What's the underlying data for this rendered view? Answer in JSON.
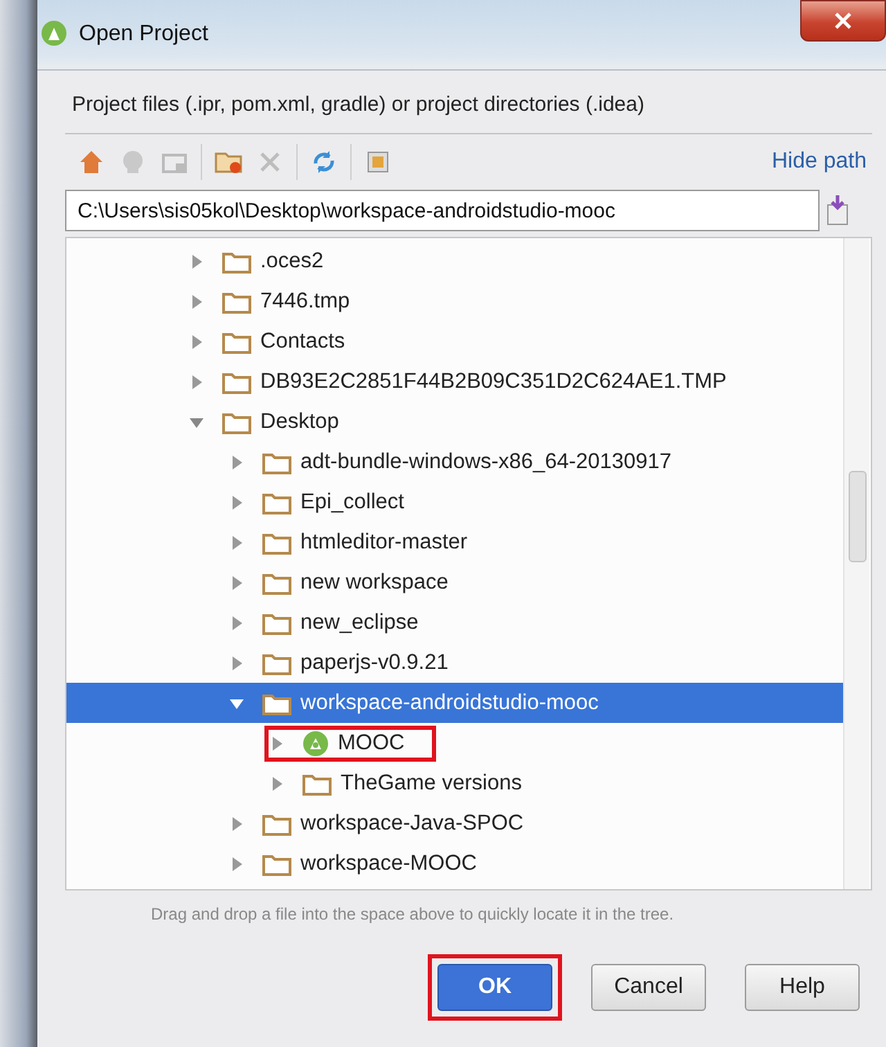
{
  "window": {
    "title": "Open Project"
  },
  "description": "Project files (.ipr, pom.xml, gradle) or project directories (.idea)",
  "toolbar": {
    "hide_path_link": "Hide path"
  },
  "path_field": {
    "value": "C:\\Users\\sis05kol\\Desktop\\workspace-androidstudio-mooc"
  },
  "tree": [
    {
      "label": ".oces2",
      "kind": "folder",
      "expanded": false,
      "selected": false,
      "highlighted": false
    },
    {
      "label": "7446.tmp",
      "kind": "folder",
      "expanded": false,
      "selected": false,
      "highlighted": false
    },
    {
      "label": "Contacts",
      "kind": "folder",
      "expanded": false,
      "selected": false,
      "highlighted": false
    },
    {
      "label": "DB93E2C2851F44B2B09C351D2C624AE1.TMP",
      "kind": "folder",
      "expanded": false,
      "selected": false,
      "highlighted": false
    },
    {
      "label": "Desktop",
      "kind": "folder",
      "expanded": true,
      "selected": false,
      "highlighted": false,
      "children": [
        {
          "label": "adt-bundle-windows-x86_64-20130917",
          "kind": "folder",
          "expanded": false,
          "selected": false,
          "highlighted": false
        },
        {
          "label": "Epi_collect",
          "kind": "folder",
          "expanded": false,
          "selected": false,
          "highlighted": false
        },
        {
          "label": "htmleditor-master",
          "kind": "folder",
          "expanded": false,
          "selected": false,
          "highlighted": false
        },
        {
          "label": "new workspace",
          "kind": "folder",
          "expanded": false,
          "selected": false,
          "highlighted": false
        },
        {
          "label": "new_eclipse",
          "kind": "folder",
          "expanded": false,
          "selected": false,
          "highlighted": false
        },
        {
          "label": "paperjs-v0.9.21",
          "kind": "folder",
          "expanded": false,
          "selected": false,
          "highlighted": false
        },
        {
          "label": "workspace-androidstudio-mooc",
          "kind": "folder",
          "expanded": true,
          "selected": true,
          "highlighted": false,
          "children": [
            {
              "label": "MOOC",
              "kind": "project",
              "expanded": false,
              "selected": false,
              "highlighted": true
            },
            {
              "label": "TheGame versions",
              "kind": "folder",
              "expanded": false,
              "selected": false,
              "highlighted": false
            }
          ]
        },
        {
          "label": "workspace-Java-SPOC",
          "kind": "folder",
          "expanded": false,
          "selected": false,
          "highlighted": false
        },
        {
          "label": "workspace-MOOC",
          "kind": "folder",
          "expanded": false,
          "selected": false,
          "highlighted": false
        }
      ]
    }
  ],
  "hint": "Drag and drop a file into the space above to quickly locate it in the tree.",
  "buttons": [
    {
      "label": "OK",
      "kind": "primary",
      "highlighted": true
    },
    {
      "label": "Cancel",
      "kind": "normal",
      "highlighted": false
    },
    {
      "label": "Help",
      "kind": "normal",
      "highlighted": false
    }
  ]
}
